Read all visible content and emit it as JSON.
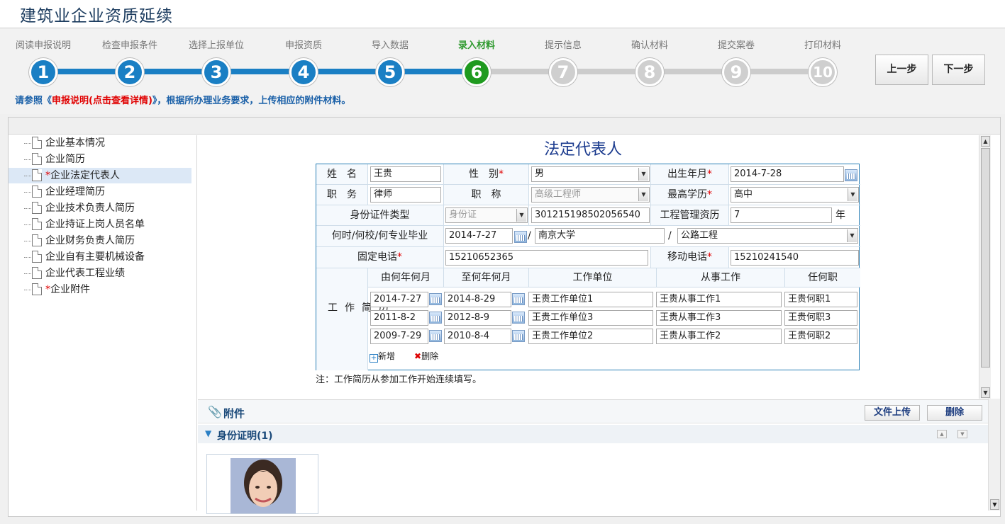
{
  "app_title": "建筑业企业资质延续",
  "steps": [
    {
      "num": "1",
      "label": "阅读申报说明",
      "state": "done"
    },
    {
      "num": "2",
      "label": "检查申报条件",
      "state": "done"
    },
    {
      "num": "3",
      "label": "选择上报单位",
      "state": "done"
    },
    {
      "num": "4",
      "label": "申报资质",
      "state": "done"
    },
    {
      "num": "5",
      "label": "导入数据",
      "state": "done"
    },
    {
      "num": "6",
      "label": "录入材料",
      "state": "active"
    },
    {
      "num": "7",
      "label": "提示信息",
      "state": "todo"
    },
    {
      "num": "8",
      "label": "确认材料",
      "state": "todo"
    },
    {
      "num": "9",
      "label": "提交案卷",
      "state": "todo"
    },
    {
      "num": "10",
      "label": "打印材料",
      "state": "todo"
    }
  ],
  "nav": {
    "prev": "上一步",
    "next": "下一步"
  },
  "hint": {
    "pre": "请参照《",
    "link": "申报说明(点击查看详情)",
    "post": "》，根据所办理业务要求，上传相应的附件材料。"
  },
  "tree": [
    {
      "label": "企业基本情况",
      "required": false,
      "selected": false
    },
    {
      "label": "企业简历",
      "required": false,
      "selected": false
    },
    {
      "label": "企业法定代表人",
      "required": true,
      "selected": true
    },
    {
      "label": "企业经理简历",
      "required": false,
      "selected": false
    },
    {
      "label": "企业技术负责人简历",
      "required": false,
      "selected": false
    },
    {
      "label": "企业持证上岗人员名单",
      "required": false,
      "selected": false
    },
    {
      "label": "企业财务负责人简历",
      "required": false,
      "selected": false
    },
    {
      "label": "企业自有主要机械设备",
      "required": false,
      "selected": false
    },
    {
      "label": "企业代表工程业绩",
      "required": false,
      "selected": false
    },
    {
      "label": "企业附件",
      "required": true,
      "selected": false
    }
  ],
  "form": {
    "title": "法定代表人",
    "name_label": "姓　名",
    "name_value": "王贵",
    "gender_label": "性　别",
    "gender_value": "男",
    "birth_label": "出生年月",
    "birth_value": "2014-7-28",
    "duty_label": "职　务",
    "duty_value": "律师",
    "title_label": "职　称",
    "title_value": "高级工程师",
    "edu_label": "最高学历",
    "edu_value": "高中",
    "id_type_label": "身份证件类型",
    "id_type_value": "身份证",
    "id_number": "301215198502056540",
    "mgmt_label": "工程管理资历",
    "mgmt_value": "7",
    "mgmt_unit": "年",
    "grad_label": "何时/何校/何专业毕业",
    "grad_date": "2014-7-27",
    "grad_school": "南京大学",
    "grad_major": "公路工程",
    "phone_label": "固定电话",
    "phone_value": "15210652365",
    "mobile_label": "移动电话",
    "mobile_value": "15210241540",
    "sep": "/",
    "resume_label": "工作简历",
    "resume_cols": [
      "由何年何月",
      "至何年何月",
      "工作单位",
      "从事工作",
      "任何职"
    ],
    "resume_rows": [
      {
        "from": "2014-7-27",
        "to": "2014-8-29",
        "unit": "王贵工作单位1",
        "work": "王贵从事工作1",
        "post": "王贵何职1"
      },
      {
        "from": "2011-8-2",
        "to": "2012-8-9",
        "unit": "王贵工作单位3",
        "work": "王贵从事工作3",
        "post": "王贵何职3"
      },
      {
        "from": "2009-7-29",
        "to": "2010-8-4",
        "unit": "王贵工作单位2",
        "work": "王贵从事工作2",
        "post": "王贵何职2"
      }
    ],
    "add_label": "新增",
    "delete_label": "删除",
    "note": "注：工作简历从参加工作开始连续填写。"
  },
  "attachments": {
    "title": "附件",
    "upload_label": "文件上传",
    "delete_label": "删除",
    "group_title": "身份证明(1)"
  },
  "colors": {
    "accent": "#1a7fc4",
    "active": "#1f9a1f",
    "todo": "#cccccc",
    "required": "#e00000"
  }
}
